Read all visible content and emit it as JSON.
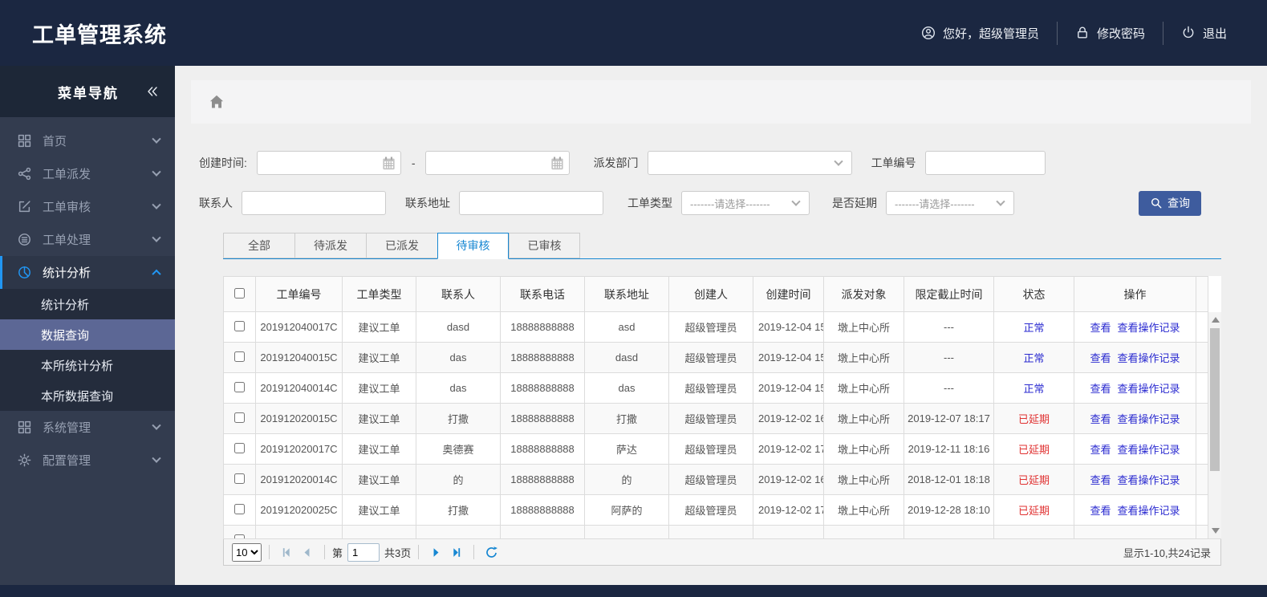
{
  "header": {
    "title": "工单管理系统",
    "greeting": "您好，超级管理员",
    "change_password": "修改密码",
    "logout": "退出"
  },
  "sidebar": {
    "nav_title": "菜单导航",
    "items": [
      {
        "key": "home",
        "label": "首页",
        "icon": "grid-icon",
        "expanded": false
      },
      {
        "key": "dispatch",
        "label": "工单派发",
        "icon": "share-icon",
        "expanded": false
      },
      {
        "key": "review",
        "label": "工单审核",
        "icon": "edit-icon",
        "expanded": false
      },
      {
        "key": "process",
        "label": "工单处理",
        "icon": "stack-icon",
        "expanded": false
      },
      {
        "key": "stats",
        "label": "统计分析",
        "icon": "pie-chart-icon",
        "expanded": true,
        "active": true,
        "children": [
          {
            "key": "stats-analysis",
            "label": "统计分析",
            "selected": false
          },
          {
            "key": "data-query",
            "label": "数据查询",
            "selected": true
          },
          {
            "key": "branch-stats-analysis",
            "label": "本所统计分析",
            "selected": false
          },
          {
            "key": "branch-data-query",
            "label": "本所数据查询",
            "selected": false
          }
        ]
      },
      {
        "key": "system",
        "label": "系统管理",
        "icon": "grid-icon",
        "expanded": false
      },
      {
        "key": "config",
        "label": "配置管理",
        "icon": "gear-icon",
        "expanded": false
      }
    ]
  },
  "filters": {
    "created_time_label": "创建时间:",
    "range_separator": "-",
    "dispatch_dept_label": "派发部门",
    "dispatch_dept_value": "",
    "order_no_label": "工单编号",
    "contact_label": "联系人",
    "address_label": "联系地址",
    "order_type_label": "工单类型",
    "order_type_value": "-------请选择-------",
    "delayed_label": "是否延期",
    "delayed_value": "-------请选择-------",
    "search_button": "查询"
  },
  "tabs": {
    "active_index": 3,
    "items": [
      {
        "key": "all",
        "label": "全部"
      },
      {
        "key": "pending-dispatch",
        "label": "待派发"
      },
      {
        "key": "dispatched",
        "label": "已派发"
      },
      {
        "key": "pending-review",
        "label": "待审核"
      },
      {
        "key": "reviewed",
        "label": "已审核"
      }
    ]
  },
  "table": {
    "columns": [
      "工单编号",
      "工单类型",
      "联系人",
      "联系电话",
      "联系地址",
      "创建人",
      "创建时间",
      "派发对象",
      "限定截止时间",
      "状态",
      "操作"
    ],
    "action_labels": [
      "查看",
      "查看操作记录"
    ],
    "rows": [
      {
        "order_no": "201912040017C",
        "order_type": "建议工单",
        "contact": "dasd",
        "phone": "18888888888",
        "address": "asd",
        "creator": "超级管理员",
        "created": "2019-12-04 15",
        "dispatch_to": "墩上中心所",
        "deadline": "---",
        "status": "正常"
      },
      {
        "order_no": "201912040015C",
        "order_type": "建议工单",
        "contact": "das",
        "phone": "18888888888",
        "address": "dasd",
        "creator": "超级管理员",
        "created": "2019-12-04 15",
        "dispatch_to": "墩上中心所",
        "deadline": "---",
        "status": "正常"
      },
      {
        "order_no": "201912040014C",
        "order_type": "建议工单",
        "contact": "das",
        "phone": "18888888888",
        "address": "das",
        "creator": "超级管理员",
        "created": "2019-12-04 15",
        "dispatch_to": "墩上中心所",
        "deadline": "---",
        "status": "正常"
      },
      {
        "order_no": "201912020015C",
        "order_type": "建议工单",
        "contact": "打撒",
        "phone": "18888888888",
        "address": "打撒",
        "creator": "超级管理员",
        "created": "2019-12-02 16",
        "dispatch_to": "墩上中心所",
        "deadline": "2019-12-07 18:17",
        "status": "已延期"
      },
      {
        "order_no": "201912020017C",
        "order_type": "建议工单",
        "contact": "奥德赛",
        "phone": "18888888888",
        "address": "萨达",
        "creator": "超级管理员",
        "created": "2019-12-02 17",
        "dispatch_to": "墩上中心所",
        "deadline": "2019-12-11 18:16",
        "status": "已延期"
      },
      {
        "order_no": "201912020014C",
        "order_type": "建议工单",
        "contact": "的",
        "phone": "18888888888",
        "address": "的",
        "creator": "超级管理员",
        "created": "2019-12-02 16",
        "dispatch_to": "墩上中心所",
        "deadline": "2018-12-01 18:18",
        "status": "已延期"
      },
      {
        "order_no": "201912020025C",
        "order_type": "建议工单",
        "contact": "打撒",
        "phone": "18888888888",
        "address": "阿萨的",
        "creator": "超级管理员",
        "created": "2019-12-02 17",
        "dispatch_to": "墩上中心所",
        "deadline": "2019-12-28 18:10",
        "status": "已延期"
      }
    ]
  },
  "pagination": {
    "page_size": "10",
    "page_prefix": "第",
    "current_page": "1",
    "total_pages": "共3页",
    "record_info": "显示1-10,共24记录"
  },
  "colors": {
    "accent_blue": "#1787d2",
    "link_blue": "#2a2ad0",
    "danger_red": "#e03131",
    "query_button_blue": "#3e5c9e",
    "sidebar_selected": "#5c6795",
    "header_navy": "#1b2741"
  }
}
